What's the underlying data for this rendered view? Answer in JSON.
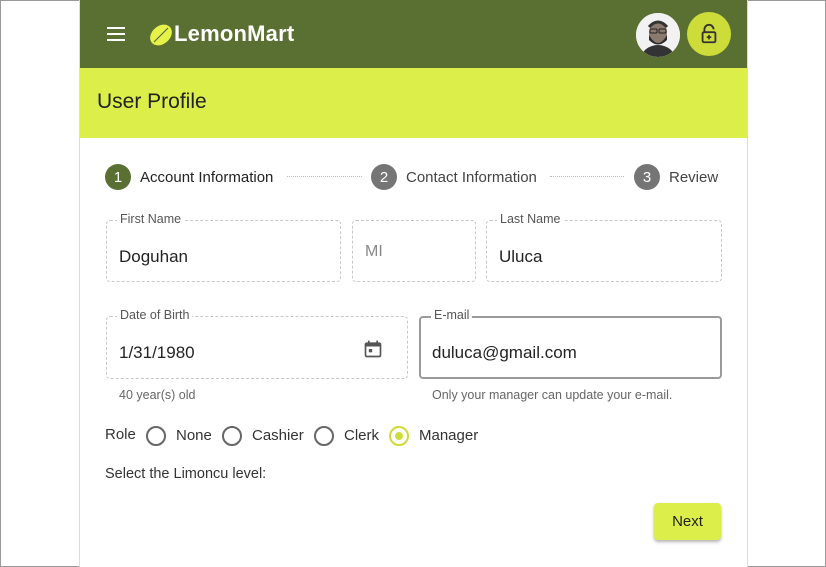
{
  "app": {
    "brand": "LemonMart"
  },
  "header": {
    "title": "User Profile"
  },
  "stepper": {
    "steps": [
      {
        "num": "1",
        "label": "Account Information"
      },
      {
        "num": "2",
        "label": "Contact Information"
      },
      {
        "num": "3",
        "label": "Review"
      }
    ]
  },
  "form": {
    "first_name": {
      "label": "First Name",
      "value": "Doguhan"
    },
    "middle_initial": {
      "placeholder": "MI"
    },
    "last_name": {
      "label": "Last Name",
      "value": "Uluca"
    },
    "dob": {
      "label": "Date of Birth",
      "value": "1/31/1980",
      "hint": "40 year(s) old"
    },
    "email": {
      "label": "E-mail",
      "value": "duluca@gmail.com",
      "hint": "Only your manager can update your e-mail."
    },
    "role": {
      "label": "Role",
      "options": [
        "None",
        "Cashier",
        "Clerk",
        "Manager"
      ],
      "selected": "Manager"
    },
    "limoncu_label": "Select the Limoncu level:"
  },
  "actions": {
    "next_label": "Next"
  },
  "colors": {
    "toolbar": "#5a7033",
    "accent": "#dcee4a",
    "lemon": "#cddc39"
  }
}
